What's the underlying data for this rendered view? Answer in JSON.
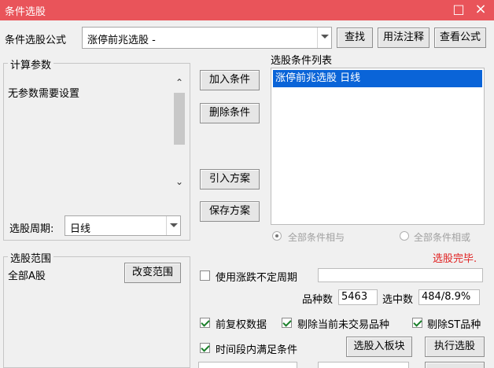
{
  "window": {
    "title": "条件选股",
    "maximize_glyph": "□",
    "close_glyph": "×"
  },
  "formula": {
    "label": "条件选股公式",
    "value": "涨停前兆选股 -",
    "find_label": "查找",
    "usage_label": "用法注释",
    "view_label": "查看公式"
  },
  "params": {
    "group_label": "计算参数",
    "text": "无参数需要设置",
    "scroll_up": "⌃",
    "scroll_down": "⌄"
  },
  "period": {
    "label": "选股周期:",
    "value": "日线"
  },
  "actions": {
    "add_label": "加入条件",
    "delete_label": "删除条件",
    "import_label": "引入方案",
    "save_label": "保存方案"
  },
  "conditions": {
    "list_label": "选股条件列表",
    "items": [
      "涨停前兆选股  日线"
    ],
    "radio_and": "全部条件相与",
    "radio_or": "全部条件相或"
  },
  "status": {
    "text": "选股完毕.",
    "color": "#e02020"
  },
  "scope": {
    "group_label": "选股范围",
    "value": "全部A股",
    "change_label": "改变范围"
  },
  "options": {
    "variable_period_label": "使用涨跌不定周期",
    "variable_period_checked": false,
    "count_label": "品种数",
    "count_value": "5463",
    "selected_label": "选中数",
    "selected_value": "484/8.9%",
    "rights_label": "前复权数据",
    "rights_checked": true,
    "exclude_untraded_label": "剔除当前未交易品种",
    "exclude_untraded_checked": true,
    "exclude_st_label": "剔除ST品种",
    "exclude_st_checked": true,
    "time_range_label": "时间段内满足条件",
    "time_range_checked": true,
    "to_block_label": "选股入板块",
    "execute_label": "执行选股"
  },
  "colors": {
    "titlebar": "#e9545a",
    "selection": "#0a64d8"
  }
}
